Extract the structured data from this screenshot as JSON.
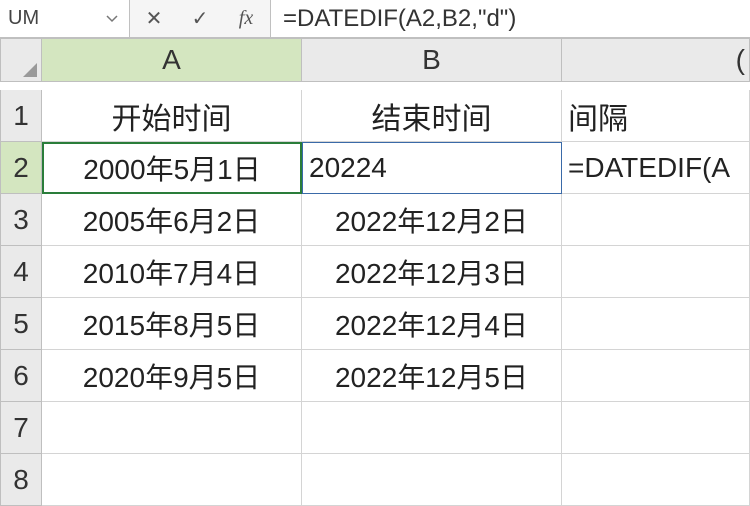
{
  "formula_bar": {
    "name_box": "UM",
    "cancel": "✕",
    "confirm": "✓",
    "fx": "fx",
    "formula": "=DATEDIF(A2,B2,\"d\")"
  },
  "columns": [
    "A",
    "B",
    "C_partial"
  ],
  "col_labels": {
    "a": "A",
    "b": "B",
    "c": "("
  },
  "rows": [
    "1",
    "2",
    "3",
    "4",
    "5",
    "6",
    "7",
    "8"
  ],
  "data": {
    "headers": {
      "a": "开始时间",
      "b": "结束时间",
      "c": "间隔"
    },
    "r2": {
      "a": "2000年5月1日",
      "b": "20224",
      "c": "=DATEDIF(A"
    },
    "r3": {
      "a": "2005年6月2日",
      "b": "2022年12月2日"
    },
    "r4": {
      "a": "2010年7月4日",
      "b": "2022年12月3日"
    },
    "r5": {
      "a": "2015年8月5日",
      "b": "2022年12月4日"
    },
    "r6": {
      "a": "2020年9月5日",
      "b": "2022年12月5日"
    }
  }
}
